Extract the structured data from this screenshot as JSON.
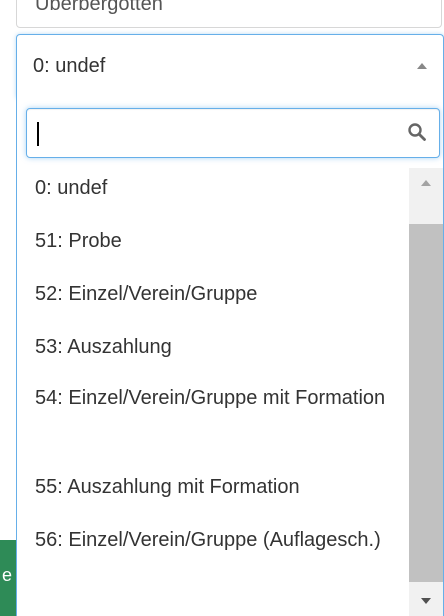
{
  "background": {
    "prev_field_text": "Überbergotten",
    "side_char": "e",
    "accent_green": "#2e8b57"
  },
  "select": {
    "value": "0: undef",
    "arrow_icon": "caret-up-icon",
    "border_color": "#66afe9"
  },
  "search": {
    "value": "",
    "placeholder": "",
    "icon": "search-icon"
  },
  "options": [
    {
      "label": "0: undef"
    },
    {
      "label": "51: Probe"
    },
    {
      "label": "52: Einzel/Verein/Gruppe"
    },
    {
      "label": "53: Auszahlung"
    },
    {
      "label": "54: Einzel/Verein/Gruppe mit Formation"
    },
    {
      "label": "55: Auszahlung mit Formation"
    },
    {
      "label": "56: Einzel/Verein/Gruppe (Auflagesch.)"
    }
  ],
  "scrollbar": {
    "up_icon": "scroll-up-arrow-icon",
    "down_icon": "scroll-down-arrow-icon"
  }
}
